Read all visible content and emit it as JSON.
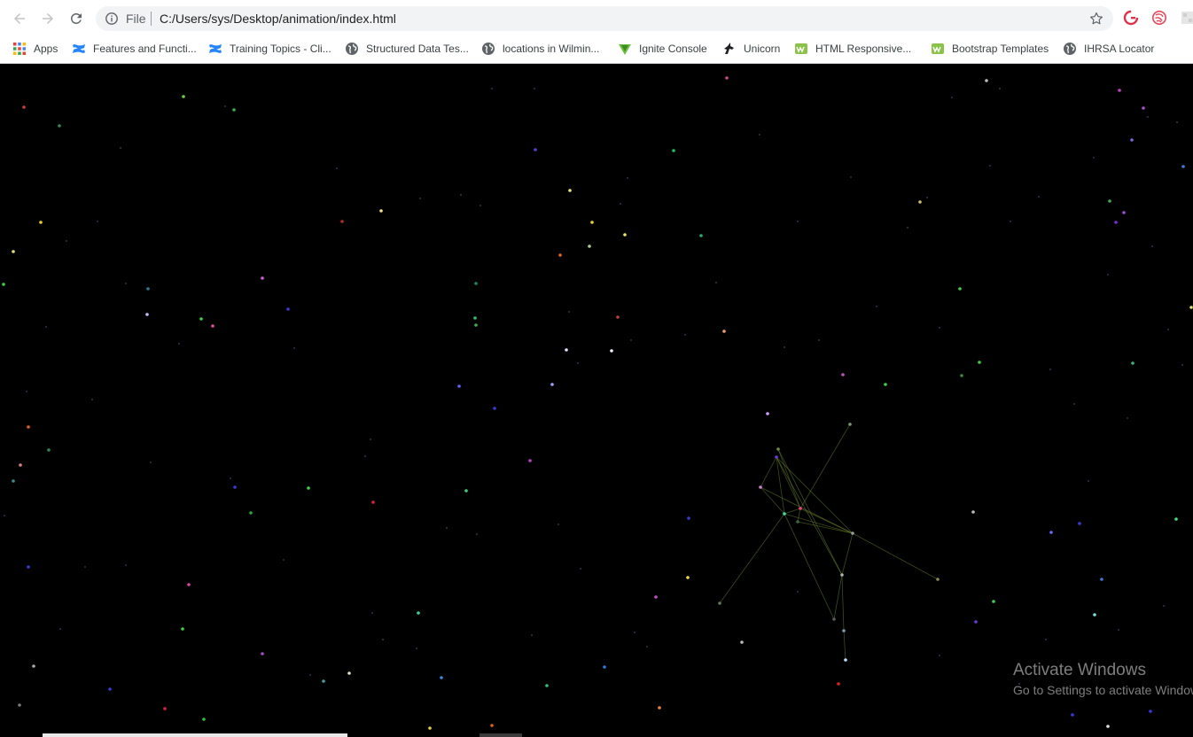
{
  "browser": {
    "omnibox": {
      "scheme_label": "File",
      "url": "C:/Users/sys/Desktop/animation/index.html"
    },
    "bookmarks": [
      {
        "label": "Apps",
        "icon": "apps-grid-icon"
      },
      {
        "label": "Features and Functi...",
        "icon": "confluence-icon"
      },
      {
        "label": "Training Topics - Cli...",
        "icon": "confluence-icon"
      },
      {
        "label": "Structured Data Tes...",
        "icon": "globe-icon"
      },
      {
        "label": "locations in Wilmin...",
        "icon": "globe-icon"
      },
      {
        "label": "Ignite Console",
        "icon": "ignite-icon"
      },
      {
        "label": "Unicorn",
        "icon": "unicorn-icon"
      },
      {
        "label": "HTML Responsive...",
        "icon": "w3layouts-icon"
      },
      {
        "label": "Bootstrap Templates",
        "icon": "w3layouts-icon"
      },
      {
        "label": "IHRSA Locator",
        "icon": "globe-icon"
      }
    ],
    "extensions": [
      "grammarly-icon",
      "extension-swirl-icon",
      "extension-puzzle-icon"
    ]
  },
  "watermark": {
    "title": "Activate Windows",
    "subtitle": "Go to Settings to activate Windows."
  }
}
